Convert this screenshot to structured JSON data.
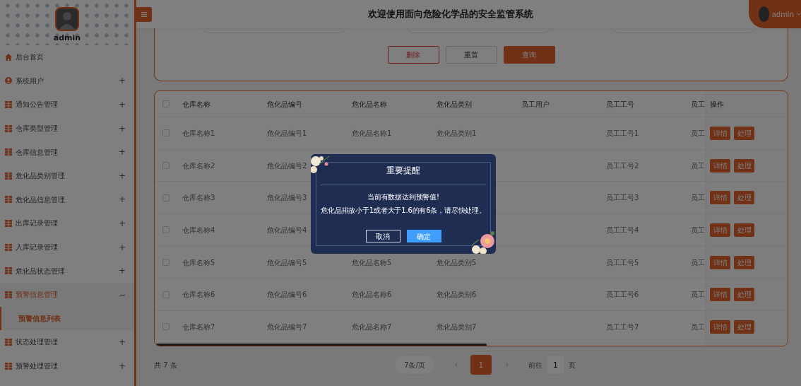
{
  "sidebar": {
    "user": "admin",
    "items": [
      {
        "label": "后台首页",
        "kind": "home",
        "selected": false
      },
      {
        "label": "系统用户",
        "kind": "user",
        "toggle": "+",
        "selected": false
      },
      {
        "label": "通知公告管理",
        "kind": "menu",
        "toggle": "+",
        "selected": false
      },
      {
        "label": "仓库类型管理",
        "kind": "menu",
        "toggle": "+",
        "selected": false
      },
      {
        "label": "仓库信息管理",
        "kind": "menu",
        "toggle": "+",
        "selected": false
      },
      {
        "label": "危化品类别管理",
        "kind": "menu",
        "toggle": "+",
        "selected": false
      },
      {
        "label": "危化品信息管理",
        "kind": "menu",
        "toggle": "+",
        "selected": false
      },
      {
        "label": "出库记录管理",
        "kind": "menu",
        "toggle": "+",
        "selected": false
      },
      {
        "label": "入库记录管理",
        "kind": "menu",
        "toggle": "+",
        "selected": false
      },
      {
        "label": "危化品状态管理",
        "kind": "menu",
        "toggle": "+",
        "selected": false
      },
      {
        "label": "预警信息管理",
        "kind": "menu",
        "toggle": "−",
        "selected": true,
        "children": [
          {
            "label": "预警信息列表",
            "selected": true
          }
        ]
      },
      {
        "label": "状态处理管理",
        "kind": "menu",
        "toggle": "+",
        "selected": false
      },
      {
        "label": "预警处理管理",
        "kind": "menu",
        "toggle": "+",
        "selected": false
      }
    ]
  },
  "header": {
    "title": "欢迎使用面向危险化学品的安全监管系统",
    "user": "admin"
  },
  "search": {
    "buttons": [
      {
        "label": "删除",
        "kind": "danger"
      },
      {
        "label": "重置",
        "kind": "plain"
      },
      {
        "label": "查询",
        "kind": "primary"
      }
    ]
  },
  "table": {
    "all_checked": false,
    "columns": [
      "仓库名称",
      "危化品编号",
      "危化品名称",
      "危化品类别",
      "员工用户",
      "员工工号",
      "员工"
    ],
    "action_column": "操作",
    "rows": [
      {
        "checked": false,
        "cells": [
          "仓库名称1",
          "危化品编号1",
          "危化品名称1",
          "危化品类别1",
          null,
          "员工工号1",
          "员工"
        ],
        "actions": [
          "详情",
          "处理"
        ]
      },
      {
        "checked": false,
        "cells": [
          "仓库名称2",
          "危化品编号2",
          null,
          null,
          null,
          "员工工号2",
          "员工"
        ],
        "actions": [
          "详情",
          "处理"
        ]
      },
      {
        "checked": false,
        "cells": [
          "仓库名称3",
          "危化品编号3",
          null,
          null,
          null,
          "员工工号3",
          "员工"
        ],
        "actions": [
          "详情",
          "处理"
        ]
      },
      {
        "checked": false,
        "cells": [
          "仓库名称4",
          "危化品编号4",
          null,
          null,
          null,
          "员工工号4",
          "员工"
        ],
        "actions": [
          "详情",
          "处理"
        ]
      },
      {
        "checked": false,
        "cells": [
          "仓库名称5",
          "危化品编号5",
          "危化品名称5",
          "危化品类别5",
          null,
          "员工工号5",
          "员工"
        ],
        "actions": [
          "详情",
          "处理"
        ]
      },
      {
        "checked": false,
        "cells": [
          "仓库名称6",
          "危化品编号6",
          "危化品名称6",
          "危化品类别6",
          null,
          "员工工号6",
          "员工"
        ],
        "actions": [
          "详情",
          "处理"
        ]
      },
      {
        "checked": false,
        "cells": [
          "仓库名称7",
          "危化品编号7",
          "危化品名称7",
          "危化品类别7",
          null,
          "员工工号7",
          "员工"
        ],
        "actions": [
          "详情",
          "处理"
        ]
      }
    ]
  },
  "pagination": {
    "total": "共 7 条",
    "page_size": "7条/页",
    "prev": "‹",
    "pages": [
      {
        "label": "1",
        "selected": true
      }
    ],
    "next": "›",
    "goto_label": "前往",
    "goto_value": "1",
    "goto_suffix": "页"
  },
  "dialog": {
    "title": "重要提醒",
    "lines": [
      "当前有数据达到预警值!",
      "危化品排放小于1或者大于1.6的有6条，请尽快处理。"
    ],
    "cancel": "取消",
    "confirm": "确定"
  }
}
